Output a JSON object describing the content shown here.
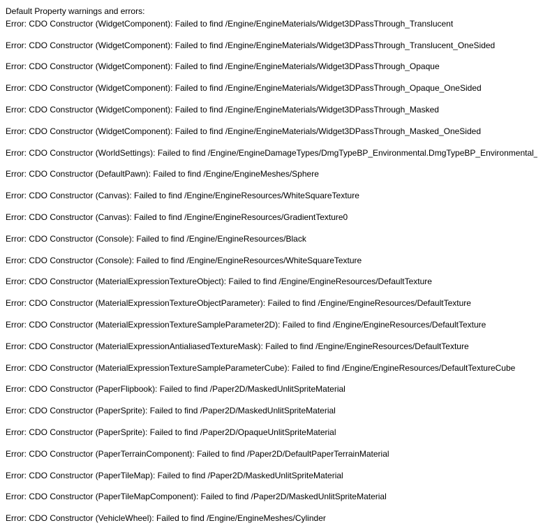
{
  "log": {
    "header": "Default Property warnings and errors:",
    "entries": [
      "Error: CDO Constructor (WidgetComponent): Failed to find /Engine/EngineMaterials/Widget3DPassThrough_Translucent",
      "Error: CDO Constructor (WidgetComponent): Failed to find /Engine/EngineMaterials/Widget3DPassThrough_Translucent_OneSided",
      "Error: CDO Constructor (WidgetComponent): Failed to find /Engine/EngineMaterials/Widget3DPassThrough_Opaque",
      "Error: CDO Constructor (WidgetComponent): Failed to find /Engine/EngineMaterials/Widget3DPassThrough_Opaque_OneSided",
      "Error: CDO Constructor (WidgetComponent): Failed to find /Engine/EngineMaterials/Widget3DPassThrough_Masked",
      "Error: CDO Constructor (WidgetComponent): Failed to find /Engine/EngineMaterials/Widget3DPassThrough_Masked_OneSided",
      "Error: CDO Constructor (WorldSettings): Failed to find /Engine/EngineDamageTypes/DmgTypeBP_Environmental.DmgTypeBP_Environmental_C",
      "Error: CDO Constructor (DefaultPawn): Failed to find /Engine/EngineMeshes/Sphere",
      "Error: CDO Constructor (Canvas): Failed to find /Engine/EngineResources/WhiteSquareTexture",
      "Error: CDO Constructor (Canvas): Failed to find /Engine/EngineResources/GradientTexture0",
      "Error: CDO Constructor (Console): Failed to find /Engine/EngineResources/Black",
      "Error: CDO Constructor (Console): Failed to find /Engine/EngineResources/WhiteSquareTexture",
      "Error: CDO Constructor (MaterialExpressionTextureObject): Failed to find /Engine/EngineResources/DefaultTexture",
      "Error: CDO Constructor (MaterialExpressionTextureObjectParameter): Failed to find /Engine/EngineResources/DefaultTexture",
      "Error: CDO Constructor (MaterialExpressionTextureSampleParameter2D): Failed to find /Engine/EngineResources/DefaultTexture",
      "Error: CDO Constructor (MaterialExpressionAntialiasedTextureMask): Failed to find /Engine/EngineResources/DefaultTexture",
      "Error: CDO Constructor (MaterialExpressionTextureSampleParameterCube): Failed to find /Engine/EngineResources/DefaultTextureCube",
      "Error: CDO Constructor (PaperFlipbook): Failed to find /Paper2D/MaskedUnlitSpriteMaterial",
      "Error: CDO Constructor (PaperSprite): Failed to find /Paper2D/MaskedUnlitSpriteMaterial",
      "Error: CDO Constructor (PaperSprite): Failed to find /Paper2D/OpaqueUnlitSpriteMaterial",
      "Error: CDO Constructor (PaperTerrainComponent): Failed to find /Paper2D/DefaultPaperTerrainMaterial",
      "Error: CDO Constructor (PaperTileMap): Failed to find /Paper2D/MaskedUnlitSpriteMaterial",
      "Error: CDO Constructor (PaperTileMapComponent): Failed to find /Paper2D/MaskedUnlitSpriteMaterial",
      "Error: CDO Constructor (VehicleWheel): Failed to find /Engine/EngineMeshes/Cylinder"
    ]
  }
}
